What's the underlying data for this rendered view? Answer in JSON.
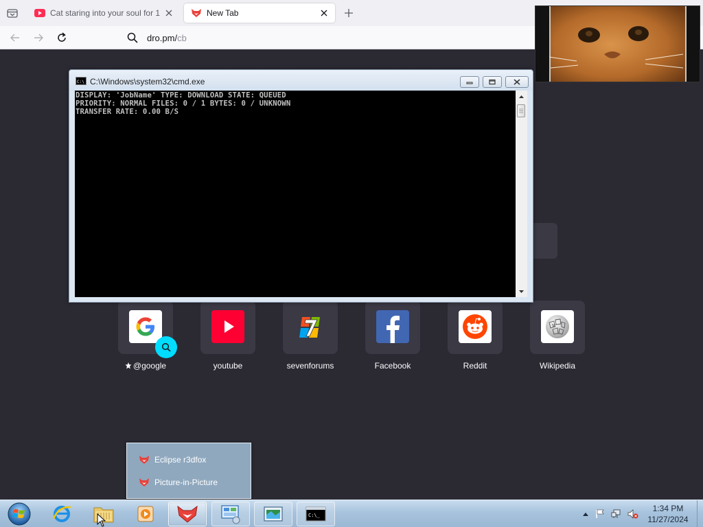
{
  "browser": {
    "tabs": [
      {
        "title": "Cat staring into your soul for 1",
        "active": false,
        "favicon": "youtube-favicon"
      },
      {
        "title": "New Tab",
        "active": true,
        "favicon": "r3dfox-favicon"
      }
    ],
    "url_host": "dro.pm/",
    "url_path": "cb"
  },
  "cmd_window": {
    "title": "C:\\Windows\\system32\\cmd.exe",
    "lines": [
      "DISPLAY: 'JobName' TYPE: DOWNLOAD STATE: QUEUED",
      "PRIORITY: NORMAL FILES: 0 / 1 BYTES: 0 / UNKNOWN",
      "TRANSFER RATE: 0.00 B/S"
    ]
  },
  "shortcuts": [
    {
      "label": "@google",
      "icon": "google-icon",
      "pinned": true
    },
    {
      "label": "youtube",
      "icon": "youtube-icon"
    },
    {
      "label": "sevenforums",
      "icon": "sevenforums-icon"
    },
    {
      "label": "Facebook",
      "icon": "facebook-icon"
    },
    {
      "label": "Reddit",
      "icon": "reddit-icon"
    },
    {
      "label": "Wikipedia",
      "icon": "wikipedia-icon"
    }
  ],
  "jumplist": {
    "items": [
      {
        "label": "Eclipse r3dfox"
      },
      {
        "label": "Picture-in-Picture"
      }
    ]
  },
  "taskbar": {
    "time": "1:34 PM",
    "date": "11/27/2024"
  },
  "colors": {
    "newtab_bg": "#2b2a33",
    "tile_bg": "#3a3944",
    "accent_cyan": "#00ddff"
  }
}
